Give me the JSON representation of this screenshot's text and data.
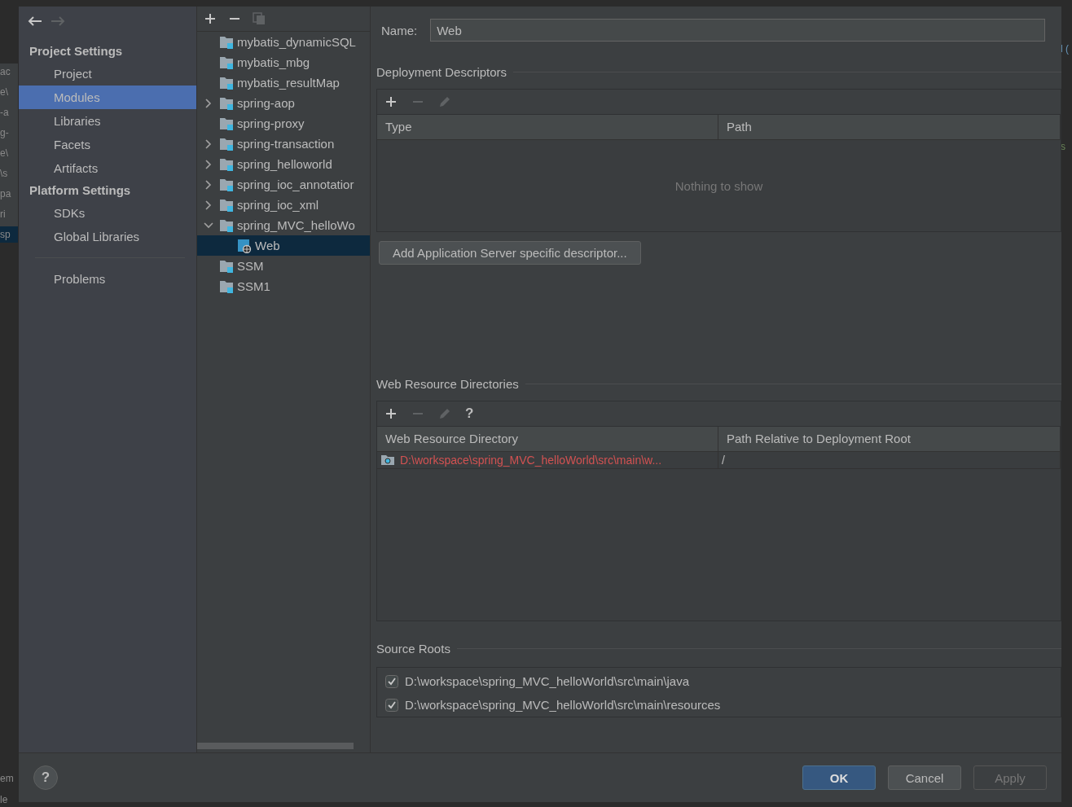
{
  "background_ide": {
    "left_fragments": [
      "ac",
      "e\\",
      "-a",
      "g-",
      "e\\",
      "\\s",
      "pa",
      "ri",
      "sp"
    ],
    "bottom_fragments": [
      "em",
      "le"
    ],
    "right_fragments": [
      "l (",
      "s"
    ]
  },
  "nav": [
    {
      "kind": "back",
      "disabled": false
    },
    {
      "kind": "forward",
      "disabled": true
    }
  ],
  "sidebar": {
    "sections": [
      {
        "title": "Project Settings",
        "items": [
          {
            "label": "Project",
            "selected": false
          },
          {
            "label": "Modules",
            "selected": true
          },
          {
            "label": "Libraries",
            "selected": false
          },
          {
            "label": "Facets",
            "selected": false
          },
          {
            "label": "Artifacts",
            "selected": false
          }
        ]
      },
      {
        "title": "Platform Settings",
        "items": [
          {
            "label": "SDKs",
            "selected": false
          },
          {
            "label": "Global Libraries",
            "selected": false
          }
        ]
      }
    ],
    "extra_items": [
      {
        "label": "Problems",
        "selected": false
      }
    ]
  },
  "tree": {
    "toolbar": [
      {
        "kind": "add",
        "disabled": false
      },
      {
        "kind": "remove",
        "disabled": false
      },
      {
        "kind": "copy",
        "disabled": true
      }
    ],
    "nodes": [
      {
        "label": "mybatis_dynamicSQL",
        "kind": "module",
        "expandable": false,
        "selected": false
      },
      {
        "label": "mybatis_mbg",
        "kind": "module",
        "expandable": false,
        "selected": false
      },
      {
        "label": "mybatis_resultMap",
        "kind": "module",
        "expandable": false,
        "selected": false
      },
      {
        "label": "spring-aop",
        "kind": "module",
        "expandable": true,
        "expanded": false,
        "selected": false
      },
      {
        "label": "spring-proxy",
        "kind": "module",
        "expandable": false,
        "selected": false
      },
      {
        "label": "spring-transaction",
        "kind": "module",
        "expandable": true,
        "expanded": false,
        "selected": false
      },
      {
        "label": "spring_helloworld",
        "kind": "module",
        "expandable": true,
        "expanded": false,
        "selected": false
      },
      {
        "label": "spring_ioc_annotatior",
        "kind": "module",
        "expandable": true,
        "expanded": false,
        "selected": false
      },
      {
        "label": "spring_ioc_xml",
        "kind": "module",
        "expandable": true,
        "expanded": false,
        "selected": false
      },
      {
        "label": "spring_MVC_helloWo",
        "kind": "module",
        "expandable": true,
        "expanded": true,
        "selected": false,
        "children": [
          {
            "label": "Web",
            "kind": "web",
            "expandable": false,
            "selected": true
          }
        ]
      },
      {
        "label": "SSM",
        "kind": "module",
        "expandable": false,
        "selected": false
      },
      {
        "label": "SSM1",
        "kind": "module",
        "expandable": false,
        "selected": false
      }
    ]
  },
  "name_field": {
    "label": "Name:",
    "value": "Web"
  },
  "deployment_descriptors": {
    "title": "Deployment Descriptors",
    "toolbar": [
      {
        "kind": "add",
        "disabled": false
      },
      {
        "kind": "remove",
        "disabled": true
      },
      {
        "kind": "edit",
        "disabled": true
      }
    ],
    "columns": [
      "Type",
      "Path"
    ],
    "empty_text": "Nothing to show",
    "button": "Add Application Server specific descriptor..."
  },
  "web_resource_directories": {
    "title": "Web Resource Directories",
    "toolbar": [
      {
        "kind": "add",
        "disabled": false
      },
      {
        "kind": "remove",
        "disabled": true
      },
      {
        "kind": "edit",
        "disabled": true
      },
      {
        "kind": "help",
        "label": "?",
        "disabled": false
      }
    ],
    "columns": [
      "Web Resource Directory",
      "Path Relative to Deployment Root"
    ],
    "rows": [
      {
        "directory": "D:\\workspace\\spring_MVC_helloWorld\\src\\main\\w...",
        "path": "/",
        "invalid": true
      }
    ]
  },
  "source_roots": {
    "title": "Source Roots",
    "items": [
      {
        "path": "D:\\workspace\\spring_MVC_helloWorld\\src\\main\\java",
        "checked": true
      },
      {
        "path": "D:\\workspace\\spring_MVC_helloWorld\\src\\main\\resources",
        "checked": true
      }
    ]
  },
  "footer": {
    "help_label": "?",
    "buttons": [
      {
        "label": "OK",
        "kind": "primary",
        "disabled": false
      },
      {
        "label": "Cancel",
        "kind": "normal",
        "disabled": false
      },
      {
        "label": "Apply",
        "kind": "normal",
        "disabled": true
      }
    ]
  }
}
